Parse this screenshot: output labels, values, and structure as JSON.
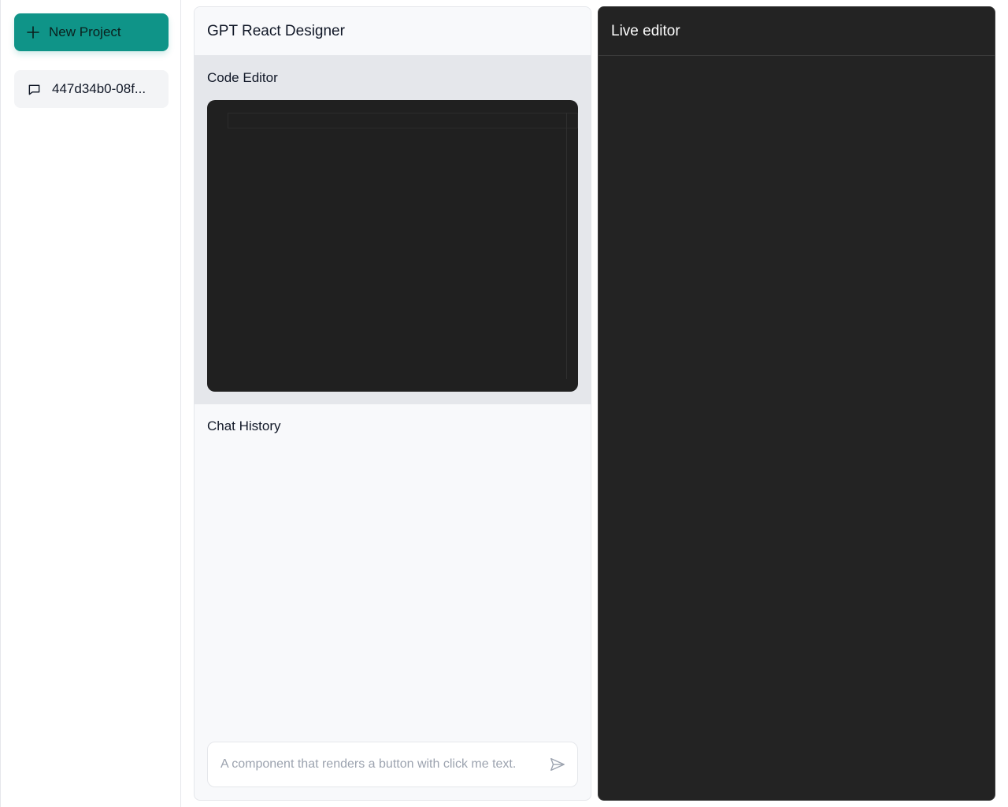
{
  "sidebar": {
    "new_project_label": "New Project",
    "projects": [
      {
        "label": "447d34b0-08f..."
      }
    ]
  },
  "main": {
    "app_title": "GPT React Designer",
    "code_editor_title": "Code Editor",
    "chat_history_title": "Chat History",
    "chat_input_placeholder": "A component that renders a button with click me text."
  },
  "live": {
    "title": "Live editor"
  },
  "colors": {
    "accent": "#0f9488",
    "editor_bg": "#202020",
    "live_bg": "#232323"
  },
  "icons": {
    "new_project": "plus-icon",
    "project_item": "chat-bubble-icon",
    "send": "send-icon"
  }
}
